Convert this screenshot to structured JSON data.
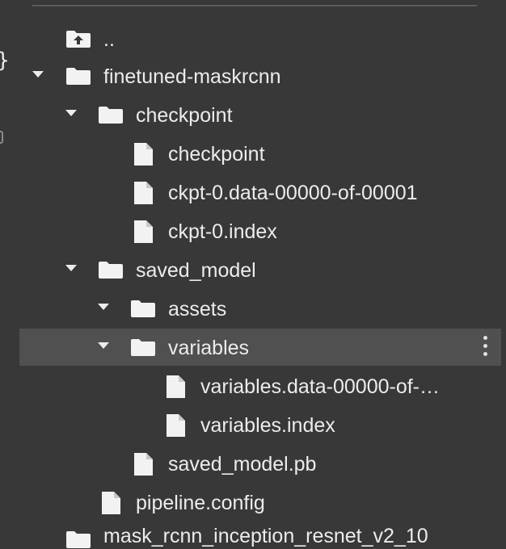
{
  "file_tree": {
    "rows": [
      {
        "label": "..",
        "icon": "folder-up-icon",
        "depth": 0
      },
      {
        "label": "finetuned-maskrcnn",
        "icon": "folder-icon",
        "depth": 0,
        "expanded": true
      },
      {
        "label": "checkpoint",
        "icon": "folder-icon",
        "depth": 1,
        "expanded": true
      },
      {
        "label": "checkpoint",
        "icon": "file-icon",
        "depth": 2
      },
      {
        "label": "ckpt-0.data-00000-of-00001",
        "icon": "file-icon",
        "depth": 2
      },
      {
        "label": "ckpt-0.index",
        "icon": "file-icon",
        "depth": 2
      },
      {
        "label": "saved_model",
        "icon": "folder-icon",
        "depth": 1,
        "expanded": true
      },
      {
        "label": "assets",
        "icon": "folder-icon",
        "depth": 2,
        "expanded": true
      },
      {
        "label": "variables",
        "icon": "folder-icon",
        "depth": 2,
        "expanded": true,
        "selected": true
      },
      {
        "label": "variables.data-00000-of-…",
        "icon": "file-icon",
        "depth": 3
      },
      {
        "label": "variables.index",
        "icon": "file-icon",
        "depth": 3
      },
      {
        "label": "saved_model.pb",
        "icon": "file-icon",
        "depth": 2
      },
      {
        "label": "pipeline.config",
        "icon": "file-icon",
        "depth": 1
      }
    ],
    "partial_last_row": "mask_rcnn_inception_resnet_v2_10"
  },
  "colors": {
    "background": "#383838",
    "selected_row": "#505050",
    "text": "#ececec"
  }
}
